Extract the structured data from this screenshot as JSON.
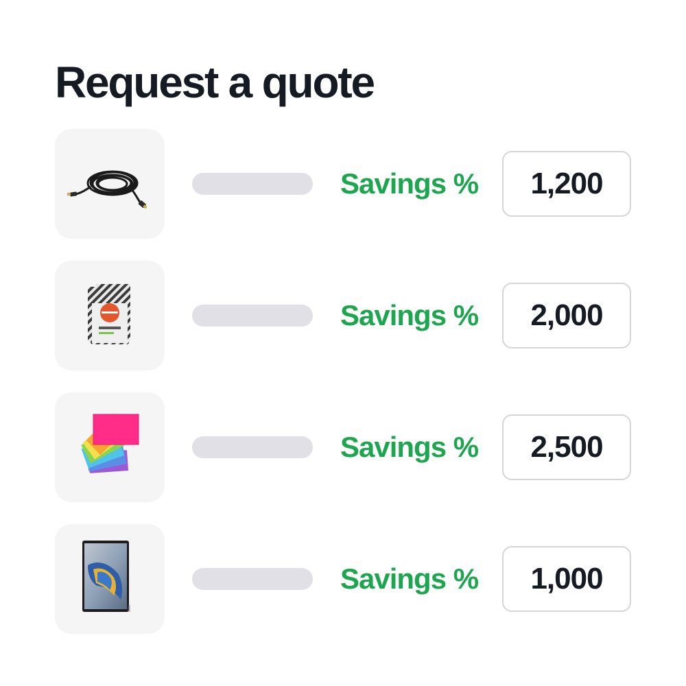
{
  "title": "Request a quote",
  "colors": {
    "title": "#151a23",
    "savings": "#1ea550",
    "placeholder_bar": "#e1e0e6",
    "thumbnail_bg": "#f5f5f5",
    "box_border": "#d6d6d6"
  },
  "items": [
    {
      "product_image": "hdmi-cable-image",
      "savings_label": "Savings %",
      "quantity": "1,200"
    },
    {
      "product_image": "coffee-bags-image",
      "savings_label": "Savings %",
      "quantity": "2,000"
    },
    {
      "product_image": "sticky-notes-image",
      "savings_label": "Savings %",
      "quantity": "2,500"
    },
    {
      "product_image": "tablet-image",
      "savings_label": "Savings %",
      "quantity": "1,000"
    }
  ]
}
